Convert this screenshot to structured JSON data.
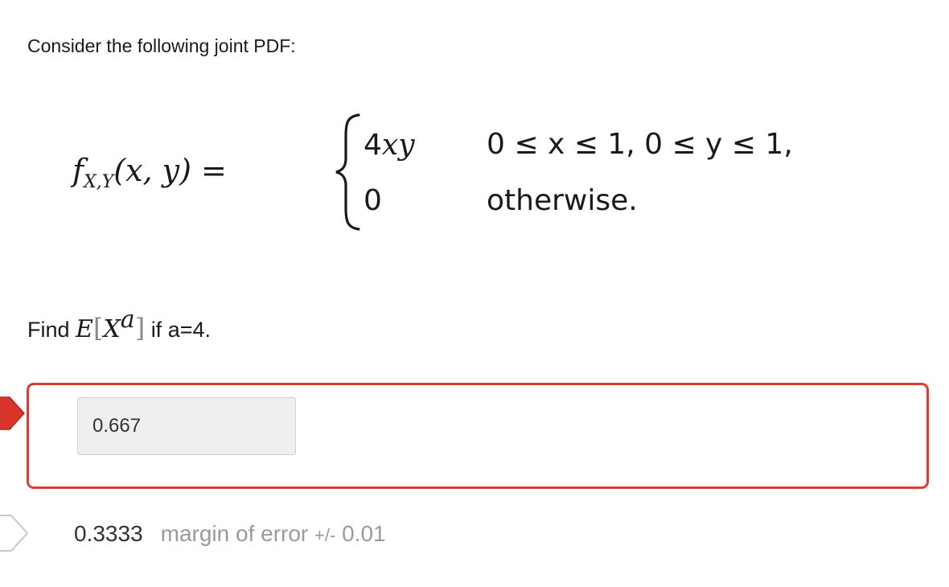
{
  "question": {
    "prompt": "Consider the following joint PDF:",
    "formula": {
      "lhs_f": "f",
      "lhs_sub": "X,Y",
      "lhs_args": "(x, y) =",
      "case1_value": "4xy",
      "case1_condition": "0 ≤ x ≤ 1, 0 ≤ y ≤ 1,",
      "case2_value": "0",
      "case2_condition": "otherwise."
    },
    "find_prefix": "Find",
    "find_E": "E",
    "find_X": "X",
    "find_sup": "a",
    "find_suffix": "if a=4."
  },
  "answer": {
    "value": "0.667",
    "status": "incorrect",
    "status_color": "#e0392d"
  },
  "correct_answer": {
    "value": "0.3333",
    "margin_label": "margin of error",
    "margin_pm": "+/-",
    "margin_value": "0.01"
  }
}
